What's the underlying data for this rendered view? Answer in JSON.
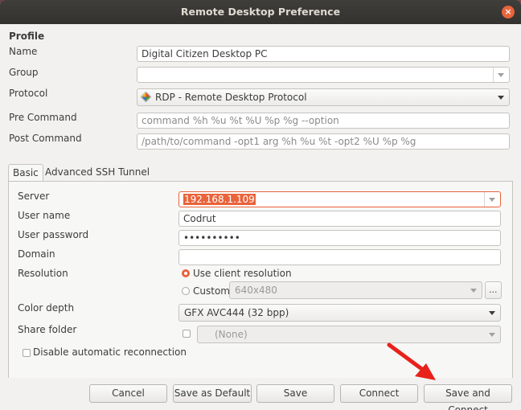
{
  "window": {
    "title": "Remote Desktop Preference",
    "close_glyph": "×"
  },
  "profile": {
    "heading": "Profile",
    "name_label": "Name",
    "name_value": "Digital Citizen Desktop PC",
    "group_label": "Group",
    "group_value": "",
    "protocol_label": "Protocol",
    "protocol_value": "RDP - Remote Desktop Protocol",
    "protocol_icon": "rdp-icon",
    "precommand_label": "Pre Command",
    "precommand_placeholder": "command %h %u %t %U %p %g --option",
    "postcommand_label": "Post Command",
    "postcommand_placeholder": "/path/to/command -opt1 arg %h %u %t -opt2 %U %p %g"
  },
  "tabs": [
    {
      "label": "Basic",
      "active": true
    },
    {
      "label": "Advanced",
      "active": false
    },
    {
      "label": "SSH Tunnel",
      "active": false
    }
  ],
  "basic": {
    "server_label": "Server",
    "server_value": "192.168.1.109",
    "username_label": "User name",
    "username_value": "Codrut",
    "password_label": "User password",
    "password_value": "••••••••••",
    "domain_label": "Domain",
    "domain_value": "",
    "resolution_label": "Resolution",
    "use_client_label": "Use client resolution",
    "use_client_selected": true,
    "custom_label": "Custom",
    "custom_value": "640x480",
    "custom_more": "...",
    "color_depth_label": "Color depth",
    "color_depth_value": "GFX AVC444 (32 bpp)",
    "share_folder_label": "Share folder",
    "share_folder_value": "(None)",
    "disable_reconnect_label": "Disable automatic reconnection",
    "disable_reconnect_checked": false
  },
  "buttons": {
    "cancel": "Cancel",
    "save_default": "Save as Default",
    "save": "Save",
    "connect": "Connect",
    "save_connect": "Save and Connect"
  },
  "colors": {
    "accent": "#e9633b",
    "annotation_arrow": "#e8211b",
    "titlebar": "#3a3935"
  }
}
